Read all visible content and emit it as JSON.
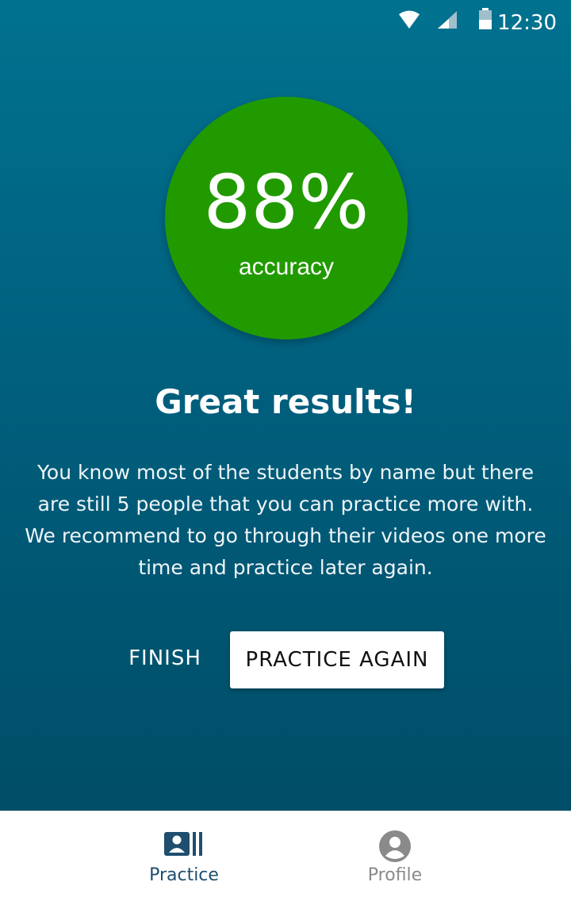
{
  "status_bar": {
    "time": "12:30",
    "icons": [
      "wifi-icon",
      "cell-signal-icon",
      "battery-icon"
    ]
  },
  "result": {
    "score": "88%",
    "score_label": "accuracy",
    "score_color": "#219a00",
    "headline": "Great results!",
    "message": "You know most of the students by name but there are still 5 people that you can practice more with. We recommend to go through their videos one more time and practice later again."
  },
  "actions": {
    "finish_label": "FINISH",
    "practice_again_label": "PRACTICE AGAIN"
  },
  "bottom_nav": {
    "items": [
      {
        "label": "Practice",
        "icon": "practice-cards-icon",
        "active": true,
        "color": "#1f4e6e"
      },
      {
        "label": "Profile",
        "icon": "profile-icon",
        "active": false,
        "color": "#8a8a8a"
      }
    ]
  },
  "colors": {
    "background_top": "#00728f",
    "background_bottom": "#004a62"
  }
}
